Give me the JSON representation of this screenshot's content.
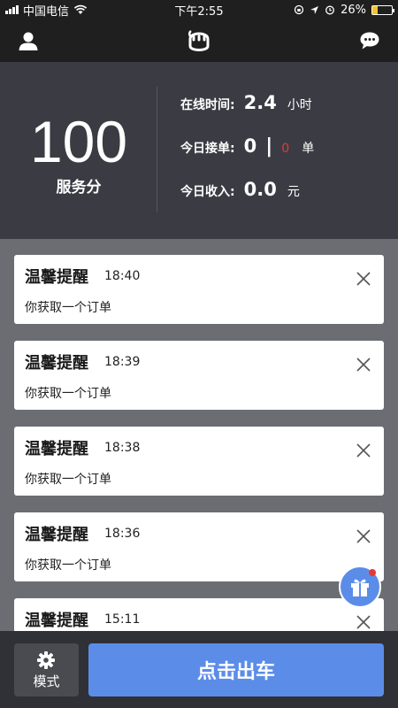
{
  "status_bar": {
    "carrier": "中国电信",
    "time": "下午2:55",
    "battery_percent": "26%",
    "battery_level": 0.26
  },
  "nav": {
    "left_icon": "user-icon",
    "center_icon": "app-logo-icon",
    "right_icon": "chat-icon"
  },
  "stats": {
    "score": "100",
    "score_label": "服务分",
    "online_label": "在线时间:",
    "online_value": "2.4",
    "online_unit": "小时",
    "orders_label": "今日接单:",
    "orders_value": "0",
    "orders_sep": "|",
    "orders_red": "0",
    "orders_unit": "单",
    "income_label": "今日收入:",
    "income_value": "0.0",
    "income_unit": "元"
  },
  "notifications": [
    {
      "title": "温馨提醒",
      "time": "18:40",
      "body": "你获取一个订单"
    },
    {
      "title": "温馨提醒",
      "time": "18:39",
      "body": "你获取一个订单"
    },
    {
      "title": "温馨提醒",
      "time": "18:38",
      "body": "你获取一个订单"
    },
    {
      "title": "温馨提醒",
      "time": "18:36",
      "body": "你获取一个订单"
    },
    {
      "title": "温馨提醒",
      "time": "15:11",
      "body": ""
    }
  ],
  "bottom": {
    "mode_label": "模式",
    "start_label": "点击出车"
  },
  "colors": {
    "accent": "#5b8de8",
    "alert_red": "#e23a3a",
    "panel": "#3b3c43",
    "background": "#6c6d72"
  }
}
